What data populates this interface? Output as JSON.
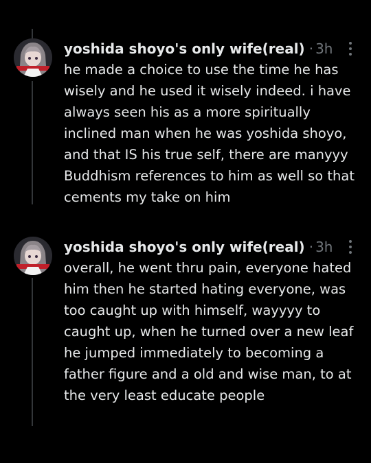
{
  "tweets": [
    {
      "display_name": "yoshida shoyo's only wife(real)",
      "separator": "·",
      "timestamp": "3h",
      "text": "he made a choice to use the time he has wisely and he used it wisely indeed. i have always seen his as a more spiritually inclined man when he was yoshida shoyo, and that IS his true self, there are manyyy Buddhism references to him as well so that cements my take on him",
      "more_icon": "more-dots-icon"
    },
    {
      "display_name": "yoshida shoyo's only wife(real)",
      "separator": "·",
      "timestamp": "3h",
      "text": "overall, he went thru pain, everyone hated him then he started hating everyone, was too caught up with himself, wayyyy to caught up, when he turned over a new leaf he jumped immediately to becoming a father figure and a old and wise man, to at the very least educate people",
      "more_icon": "more-dots-icon"
    }
  ],
  "colors": {
    "background": "#000000",
    "text": "#e7e9ea",
    "muted": "#71767b",
    "thread_line": "#333639"
  }
}
